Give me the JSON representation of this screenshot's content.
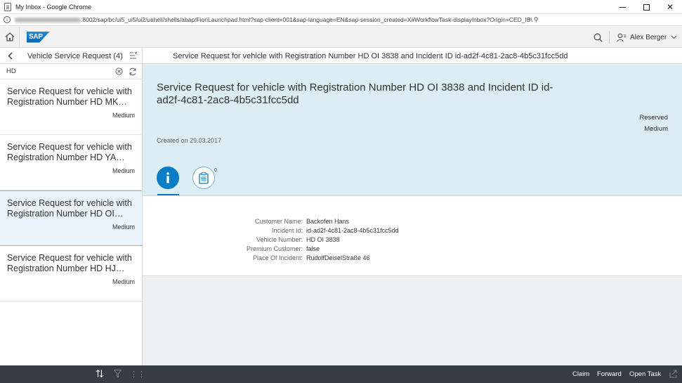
{
  "browser": {
    "window_title": "My Inbox - Google Chrome",
    "url": ":8002/sap/bc/ui5_ui5/ui2/ushell/shells/abap/FioriLaunchpad.html?sap-client=001&sap-language=EN&sap-session_created=X#WorkflowTask-displayInbox?Origin=CED_IB\\"
  },
  "shell": {
    "logo_text": "SAP",
    "user_name": "Alex Berger"
  },
  "master": {
    "title": "Vehicle Service Request (4)",
    "search_value": "HD",
    "items": [
      {
        "title": "Service Request for vehicle with Registration Number HD MK…",
        "priority": "Medium"
      },
      {
        "title": "Service Request for vehicle with Registration Number HD YA…",
        "priority": "Medium"
      },
      {
        "title": "Service Request for vehicle with Registration Number HD OI…",
        "priority": "Medium"
      },
      {
        "title": "Service Request for vehicle with Registration Number HD HJ…",
        "priority": "Medium"
      }
    ]
  },
  "detail": {
    "header_title": "Service Request for vehicle with Registration Number HD OI 3838 and Incident ID id-ad2f-4c81-2ac8-4b5c31fcc5dd",
    "object_title": "Service Request for vehicle with Registration Number HD OI 3838 and Incident ID id-ad2f-4c81-2ac8-4b5c31fcc5dd",
    "status": "Reserved",
    "priority": "Medium",
    "created": "Created on 29.03.2017",
    "notes_count": "0",
    "properties": [
      {
        "label": "Customer Name:",
        "value": "Backofen Hans"
      },
      {
        "label": "Incident Id:",
        "value": "id-ad2f-4c81-2ac8-4b5c31fcc5dd"
      },
      {
        "label": "Vehicle Number:",
        "value": "HD OI 3838"
      },
      {
        "label": "Premium Customer:",
        "value": "false"
      },
      {
        "label": "Place Of Incident:",
        "value": "RudolfDeiselStraße 46"
      }
    ]
  },
  "footer": {
    "claim": "Claim",
    "forward": "Forward",
    "open_task": "Open Task"
  },
  "colors": {
    "accent": "#0a7ec4",
    "header_bg": "#dcedf3",
    "footer_bg": "#363c44"
  }
}
